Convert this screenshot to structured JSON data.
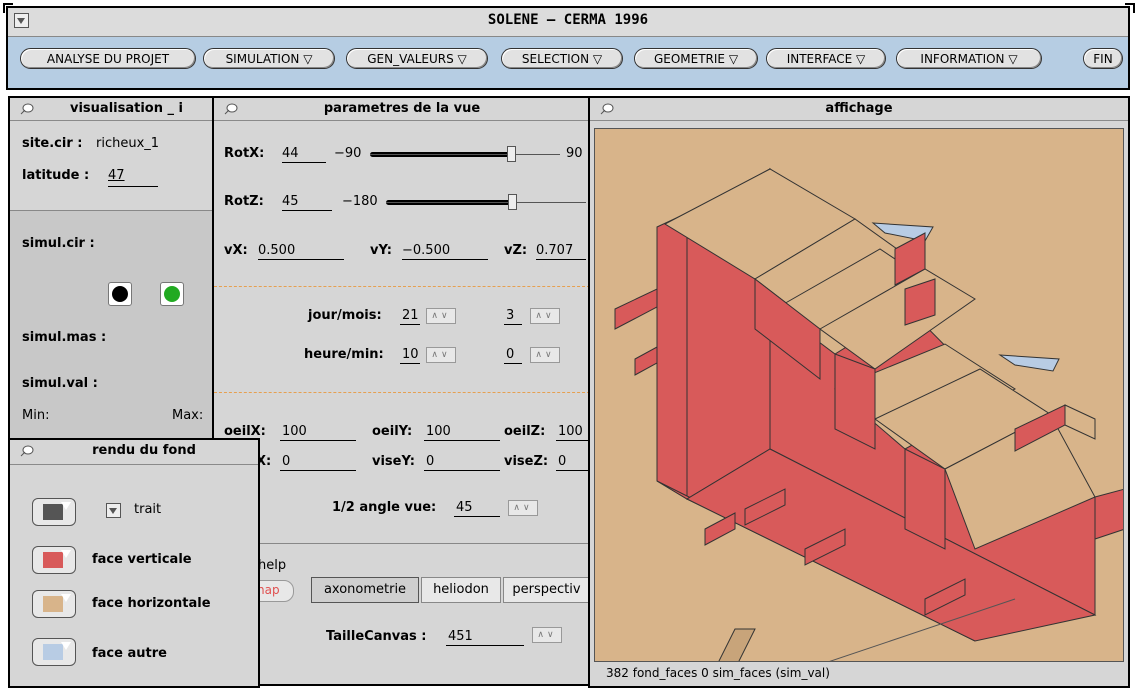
{
  "app": {
    "title": "SOLENE – CERMA 1996"
  },
  "menubar": {
    "items": [
      {
        "label": "ANALYSE DU PROJET"
      },
      {
        "label": "SIMULATION ▽"
      },
      {
        "label": "GEN_VALEURS ▽"
      },
      {
        "label": "SELECTION ▽"
      },
      {
        "label": "GEOMETRIE ▽"
      },
      {
        "label": "INTERFACE ▽"
      },
      {
        "label": "INFORMATION ▽"
      },
      {
        "label": "FIN"
      }
    ]
  },
  "visualisation": {
    "title": "visualisation _ i",
    "site_label": "site.cir :",
    "site_value": "richeux_1",
    "latitude_label": "latitude :",
    "latitude_value": "47",
    "simul_cir_label": "simul.cir :",
    "simul_mas_label": "simul.mas :",
    "simul_val_label": "simul.val :",
    "min_label": "Min:",
    "max_label": "Max:"
  },
  "rendu": {
    "title": "rendu du fond",
    "trait_label": "trait",
    "face_verticale": "face verticale",
    "face_horizontale": "face horizontale",
    "face_autre": "face autre",
    "colors": {
      "trait": "#555555",
      "verticale": "#d85a5a",
      "horizontale": "#d8b48a",
      "autre": "#b8cce4"
    }
  },
  "parametres": {
    "title": "parametres de la vue",
    "rotx_label": "RotX:",
    "rotx_value": "44",
    "rotx_min": "−90",
    "rotx_max": "90",
    "rotx_level": 0.74,
    "rotz_label": "RotZ:",
    "rotz_value": "45",
    "rotz_min": "−180",
    "rotz_level": 0.63,
    "vx_label": "vX:",
    "vx_value": "0.500",
    "vy_label": "vY:",
    "vy_value": "−0.500",
    "vz_label": "vZ:",
    "vz_value": "0.707",
    "jourmois_label": "jour/mois:",
    "jour_value": "21",
    "mois_value": "3",
    "heuremin_label": "heure/min:",
    "heure_value": "10",
    "min_value": "0",
    "oeilx_label": "oeilX:",
    "oeilx_value": "100",
    "oeily_label": "oeilY:",
    "oeily_value": "100",
    "oeilz_label": "oeilZ:",
    "oeilz_value": "100",
    "visex_label": "X:",
    "visex_value": "0",
    "visey_label": "viseY:",
    "visey_value": "0",
    "visez_label": "viseZ:",
    "visez_value": "0",
    "angle_label": "1/2 angle vue:",
    "angle_value": "45",
    "help_label": "help",
    "snap_label": "nap",
    "tabs": [
      "axonometrie",
      "heliodon",
      "perspectiv"
    ],
    "taille_label": "TailleCanvas :",
    "taille_value": "451"
  },
  "affichage": {
    "title": "affichage",
    "status": "382 fond_faces 0 sim_faces (sim_val)",
    "colors": {
      "background": "#d8b48a",
      "wall": "#d85a5a",
      "roof": "#d8b48a",
      "other": "#b8cce4"
    }
  }
}
